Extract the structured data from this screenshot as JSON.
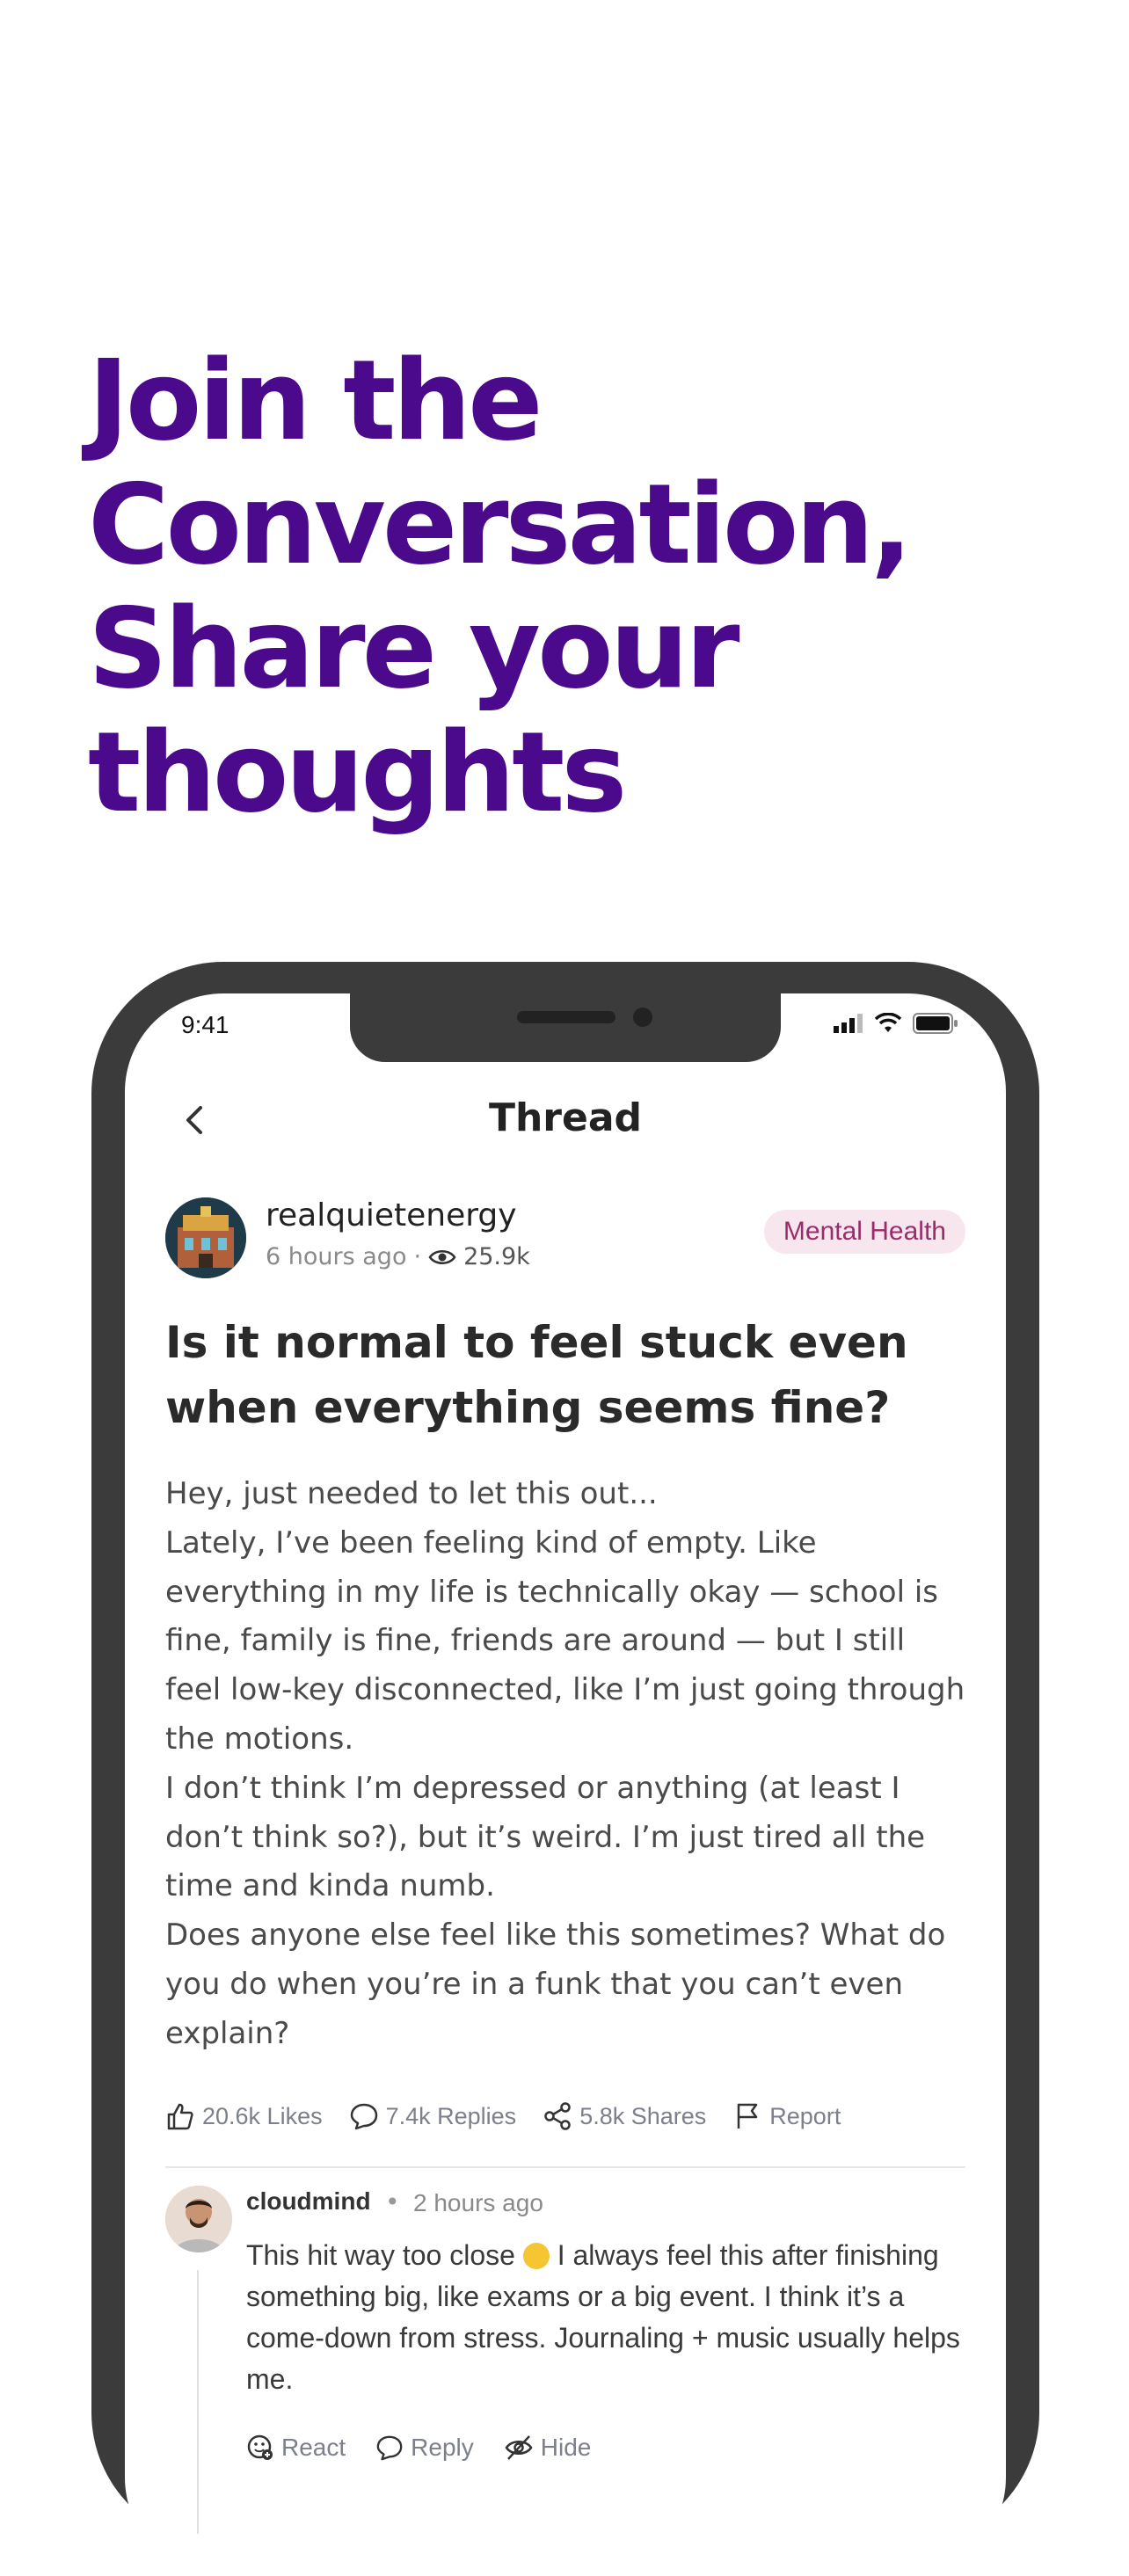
{
  "hero": {
    "lines": [
      "Join the",
      "Conversation,",
      "Share your",
      "thoughts"
    ]
  },
  "status_bar": {
    "time": "9:41"
  },
  "header": {
    "title": "Thread"
  },
  "post": {
    "author": "realquietenergy",
    "time_ago": "6 hours ago",
    "separator": "·",
    "views": "25.9k",
    "tag": "Mental Health",
    "title": "Is it normal to feel stuck even when everything seems fine?",
    "body": [
      "Hey, just needed to let this out...",
      "Lately, I’ve been feeling kind of empty. Like everything in my life is technically okay — school is fine, family is fine, friends are around — but I still feel low-key disconnected, like I’m just going through the motions.",
      "I don’t think I’m depressed or anything (at least I don’t think so?), but it’s weird. I’m just tired all the time and kinda numb.",
      "Does anyone else feel like this sometimes? What do you do when you’re in a funk that you can’t even explain?"
    ],
    "actions": {
      "likes": "20.6k Likes",
      "replies": "7.4k Replies",
      "shares": "5.8k Shares",
      "report": "Report"
    }
  },
  "comment": {
    "author": "cloudmind",
    "dot": "•",
    "time_ago": "2 hours ago",
    "text_before_emoji": "This hit way too close",
    "text_after_emoji": "I always feel this after finishing something big, like exams or a big event. I think it’s a come-down from stress. Journaling + music usually helps me.",
    "actions": {
      "react": "React",
      "reply": "Reply",
      "hide": "Hide"
    }
  },
  "colors": {
    "headline": "#4b0a8c",
    "phone_frame": "#3b3b3b",
    "tag_bg": "#f7e6ee",
    "tag_text": "#9b2b6b",
    "muted": "#7c7f8c"
  },
  "icons": {
    "back": "chevron-left-icon",
    "views": "eye-icon",
    "likes": "thumbs-up-icon",
    "replies": "chat-bubble-icon",
    "shares": "share-icon",
    "report": "flag-icon",
    "react": "emoji-add-icon",
    "reply": "chat-bubble-icon",
    "hide": "eye-off-icon"
  }
}
